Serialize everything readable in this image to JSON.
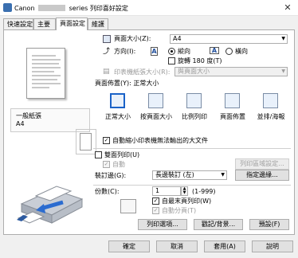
{
  "window": {
    "title_prefix": "Canon",
    "title_suffix": "series 列印喜好設定",
    "close_glyph": "✕"
  },
  "tabs": [
    {
      "label": "快速設定"
    },
    {
      "label": "主要"
    },
    {
      "label": "頁面設定"
    },
    {
      "label": "維護"
    }
  ],
  "active_tab": "頁面設定",
  "preview": {
    "media_label": "一般紙張",
    "size_label": "A4"
  },
  "page_size": {
    "label": "頁面大小(Z):",
    "value": "A4"
  },
  "orientation": {
    "label": "方向(I):",
    "portrait_label": "縱向",
    "landscape_label": "橫向",
    "selected": "portrait",
    "rotate_label": "旋轉 180 度(T)",
    "icon_letter": "A"
  },
  "printer_paper_size": {
    "label": "印表機紙張大小(R):",
    "value": "與頁面大小"
  },
  "page_layout": {
    "label": "頁面佈置(Y):",
    "current": "正常大小",
    "options": [
      {
        "label": "正常大小",
        "glyph": "▭"
      },
      {
        "label": "按頁面大小",
        "glyph": "⤢"
      },
      {
        "label": "比例列印",
        "glyph": "⇲"
      },
      {
        "label": "頁面佈置",
        "glyph": "2"
      },
      {
        "label": "並排/海報",
        "glyph": "2"
      }
    ],
    "selected_index": 0
  },
  "auto_reduce": {
    "label": "自動縮小印表機無法輸出的大文件",
    "checked": true
  },
  "duplex": {
    "label": "雙面列印(U)",
    "checked": false,
    "auto_label": "自動",
    "auto_checked": true,
    "area_button": "列印區域設定..."
  },
  "binding": {
    "label": "裝訂邊(G):",
    "value": "長邊裝訂 (左)",
    "button": "指定邊緣..."
  },
  "copies": {
    "label": "份數(C):",
    "value": "1",
    "range": "(1-999)",
    "last_page_first": {
      "label": "自最末頁列印(W)",
      "checked": true
    },
    "collate": {
      "label": "自動分頁(T)",
      "checked": true
    }
  },
  "footer_buttons": {
    "options": "列印選項...",
    "stamp": "戳記/背景...",
    "defaults": "預設(F)"
  },
  "dialog_buttons": {
    "ok": "確定",
    "cancel": "取消",
    "apply": "套用(A)",
    "help": "說明"
  },
  "colors": {
    "accent": "#1a62c8",
    "panel_bg": "#ffffff",
    "window_bg": "#f0f0f0"
  }
}
